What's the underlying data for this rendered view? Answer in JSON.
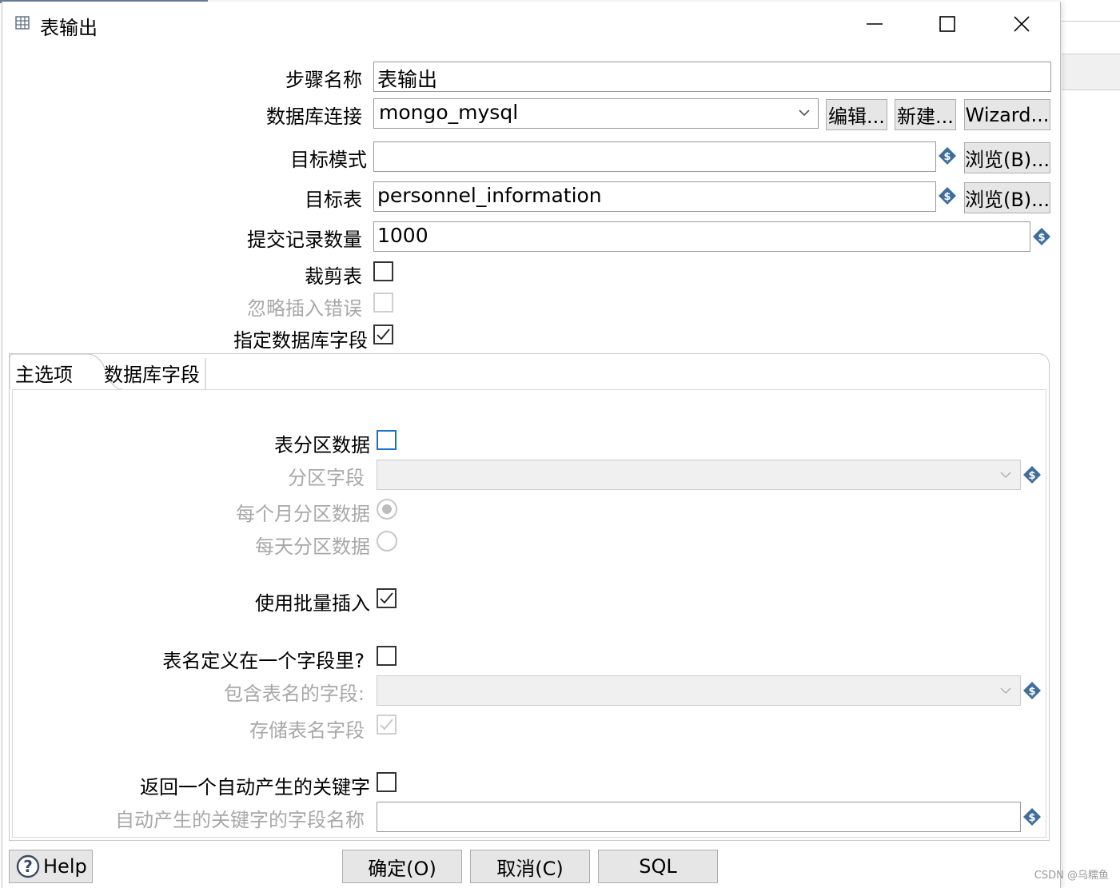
{
  "window": {
    "title": "表输出",
    "minimize_label": "minimize",
    "maximize_label": "maximize",
    "close_label": "close"
  },
  "form": {
    "step_name_label": "步骤名称",
    "step_name_value": "表输出",
    "db_connection_label": "数据库连接",
    "db_connection_value": "mongo_mysql",
    "edit_button": "编辑...",
    "new_button": "新建...",
    "wizard_button": "Wizard...",
    "target_schema_label": "目标模式",
    "target_schema_value": "",
    "browse_button": "浏览(B)...",
    "target_table_label": "目标表",
    "target_table_value": "personnel_information",
    "commit_size_label": "提交记录数量",
    "commit_size_value": "1000",
    "truncate_label": "裁剪表",
    "truncate_checked": false,
    "ignore_errors_label": "忽略插入错误",
    "ignore_errors_checked": false,
    "specify_fields_label": "指定数据库字段",
    "specify_fields_checked": true
  },
  "tabs": [
    {
      "label": "主选项",
      "active": true
    },
    {
      "label": "数据库字段",
      "active": false
    }
  ],
  "main_options": {
    "partition_label": "表分区数据",
    "partition_checked": false,
    "partition_field_label": "分区字段",
    "partition_field_value": "",
    "monthly_label": "每个月分区数据",
    "monthly_selected": true,
    "daily_label": "每天分区数据",
    "daily_selected": false,
    "batch_insert_label": "使用批量插入",
    "batch_insert_checked": true,
    "table_in_field_label": "表名定义在一个字段里?",
    "table_in_field_checked": false,
    "table_name_field_label": "包含表名的字段:",
    "table_name_field_value": "",
    "store_table_name_label": "存储表名字段",
    "store_table_name_checked": true,
    "return_key_label": "返回一个自动产生的关键字",
    "return_key_checked": false,
    "key_field_name_label": "自动产生的关键字的字段名称",
    "key_field_name_value": ""
  },
  "footer": {
    "help_button": "Help",
    "ok_button": "确定(O)",
    "cancel_button": "取消(C)",
    "sql_button": "SQL"
  },
  "watermark": "CSDN @乌糯鱼",
  "colors": {
    "variable_icon": "#3f6e99",
    "checkbox_focus": "#1a73c8",
    "button_bg": "#e6e6e6",
    "disabled_text": "#a8a8a8"
  },
  "icons": {
    "variable": "dollar-diamond-icon",
    "window": "table-output-icon",
    "help": "question-circle-icon",
    "dropdown": "chevron-down-icon"
  }
}
